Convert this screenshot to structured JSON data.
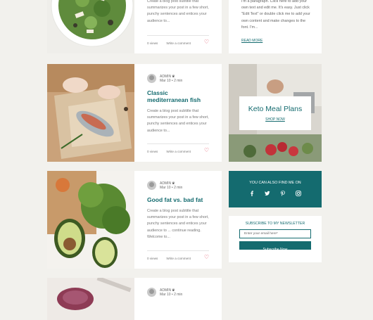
{
  "posts": [
    {
      "excerpt": "Create a blog post subtitle that summarizes your post in a few short, punchy sentences and entices your audience to...",
      "views": "0 views",
      "comment": "Write a comment"
    },
    {
      "author": "ADMIN",
      "date": "Mar 10  •  2 min",
      "title": "Classic mediterranean fish",
      "excerpt": "Create a blog post subtitle that summarizes your post in a few short, punchy sentences and entices your audience to...",
      "views": "0 views",
      "comment": "Write a comment"
    },
    {
      "author": "ADMIN",
      "date": "Mar 10  •  2 min",
      "title": "Good fat vs. bad fat",
      "excerpt": "Create a blog post subtitle that summarizes your post in a few short, punchy sentences and entices your audience to ... continue reading. Welcome to...",
      "views": "0 views",
      "comment": "Write a comment"
    },
    {
      "author": "ADMIN",
      "date": "Mar 10  •  2 min"
    }
  ],
  "about": {
    "text": "I'm a paragraph. Click here to add your own text and edit me. It's easy. Just click \"Edit Text\" or double click me to add your own content and make changes to the font. I'm...",
    "read_more": "READ MORE"
  },
  "promo": {
    "title": "Keto Meal Plans",
    "link": "SHOP NOW"
  },
  "social": {
    "heading": "YOU CAN ALSO FIND ME ON",
    "icons": [
      "facebook-icon",
      "twitter-icon",
      "pinterest-icon",
      "instagram-icon"
    ]
  },
  "newsletter": {
    "heading": "SUBSCRIBE TO MY NEWSLETTER",
    "placeholder": "Enter your email here*",
    "button": "Subscribe Now"
  },
  "colors": {
    "teal": "#146b6f",
    "heart": "#e2475c",
    "page_bg": "#f2f1ed"
  }
}
